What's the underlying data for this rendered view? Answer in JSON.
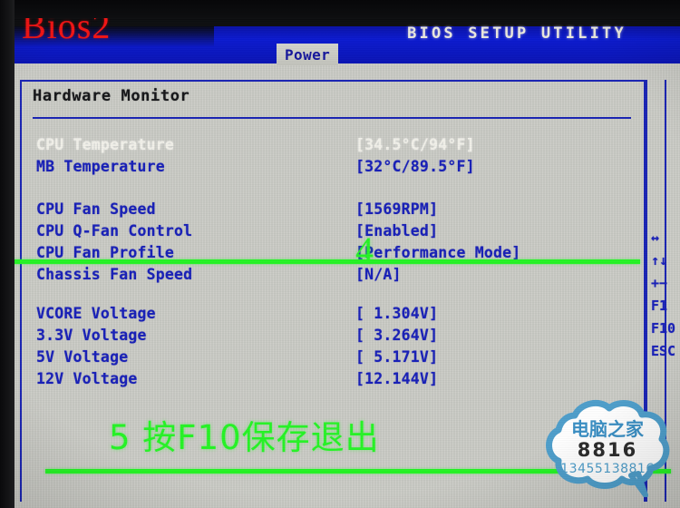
{
  "window": {
    "utility_title": "BIOS SETUP UTILITY",
    "active_tab": "Power"
  },
  "section": {
    "title": "Hardware Monitor"
  },
  "monitor_rows": [
    {
      "label": "CPU Temperature",
      "value": "[34.5°C/94°F]",
      "style": "white"
    },
    {
      "label": "MB Temperature",
      "value": "[32°C/89.5°F]",
      "style": "blue"
    },
    {
      "label": "CPU Fan Speed",
      "value": "[1569RPM]",
      "style": "blue"
    },
    {
      "label": "CPU Q-Fan Control",
      "value": "[Enabled]",
      "style": "blue"
    },
    {
      "label": "CPU Fan Profile",
      "value": "[Performance Mode]",
      "style": "blue"
    },
    {
      "label": "Chassis Fan Speed",
      "value": "[N/A]",
      "style": "blue"
    },
    {
      "label": "VCORE  Voltage",
      "value": "[ 1.304V]",
      "style": "blue"
    },
    {
      "label": "3.3V  Voltage",
      "value": "[ 3.264V]",
      "style": "blue"
    },
    {
      "label": "5V  Voltage",
      "value": "[ 5.171V]",
      "style": "blue"
    },
    {
      "label": "12V  Voltage",
      "value": "[12.144V]",
      "style": "blue"
    }
  ],
  "help_keys": [
    {
      "key": "↔"
    },
    {
      "key": "↑↓"
    },
    {
      "key": "+−"
    },
    {
      "key": "F1"
    },
    {
      "key": "F10"
    },
    {
      "key": "ESC"
    }
  ],
  "annotations": {
    "top_label": "Bios2",
    "step_number": "4",
    "instruction": "5  按F10保存退出"
  },
  "watermark": {
    "name": "电脑之家",
    "code": "8816",
    "phone": "13455138816"
  },
  "colors": {
    "bios_blue": "#1820b8",
    "menu_blue": "#0b1ad0",
    "panel_gray": "#c9cac4",
    "anno_green": "#25f425",
    "anno_red": "#f41414",
    "watermark_blue": "#4e9ecb"
  }
}
